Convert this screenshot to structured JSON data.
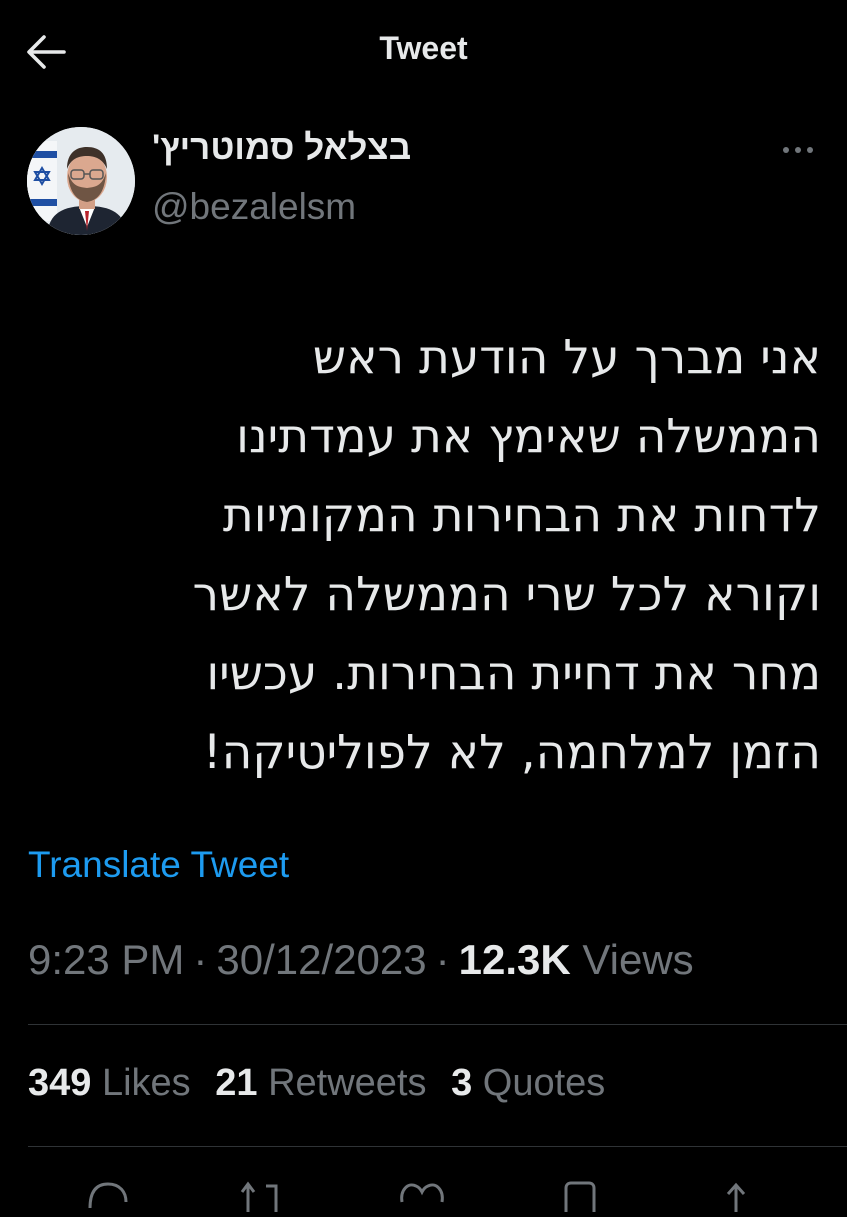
{
  "header": {
    "title": "Tweet"
  },
  "tweet": {
    "author": {
      "name": "בצלאל סמוטריץ'",
      "handle": "@bezalelsm"
    },
    "text_lines": [
      "אני מברך על הודעת ראש",
      "הממשלה שאימץ את עמדתינו",
      "לדחות את הבחירות המקומיות",
      "וקורא לכל שרי הממשלה לאשר",
      "מחר את דחיית הבחירות. עכשיו",
      "הזמן למלחמה, לא לפוליטיקה!"
    ],
    "translate_label": "Translate Tweet",
    "time": "9:23 PM",
    "separator": "·",
    "date": "30/12/2023",
    "views_count": "12.3K",
    "views_label": "Views"
  },
  "stats": {
    "likes_count": "349",
    "likes_label": "Likes",
    "retweets_count": "21",
    "retweets_label": "Retweets",
    "quotes_count": "3",
    "quotes_label": "Quotes"
  },
  "colors": {
    "background": "#000000",
    "text": "#e7e9ea",
    "muted": "#71767b",
    "accent": "#1d9bf0",
    "divider": "#2f3336"
  },
  "icons": [
    "back-arrow-icon",
    "more-icon",
    "reply-icon",
    "retweet-icon",
    "like-icon",
    "bookmark-icon",
    "share-icon"
  ]
}
